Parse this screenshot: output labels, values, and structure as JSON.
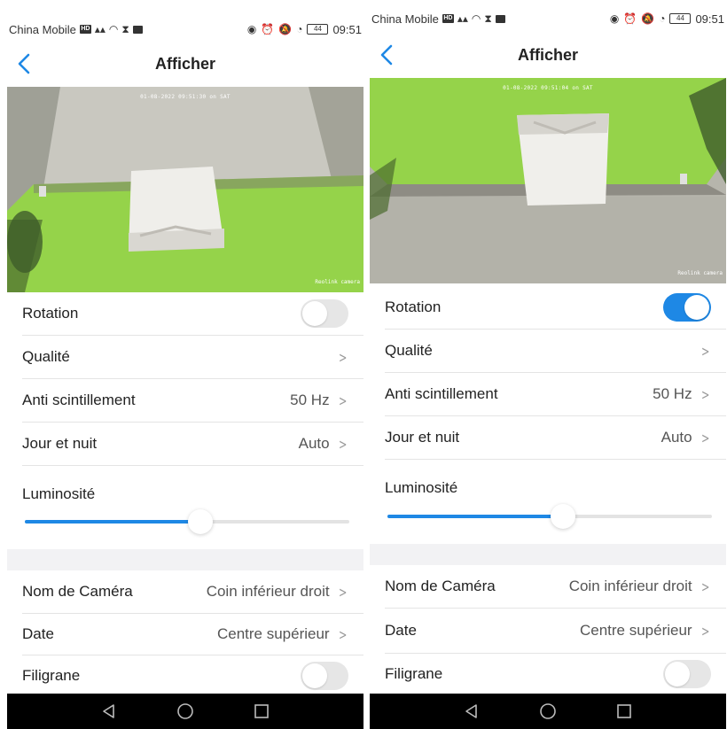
{
  "status_bar": {
    "carrier": "China Mobile",
    "hd_badge": "HD",
    "network": "4G",
    "battery": "44",
    "time": "09:51",
    "time_right": "09:51"
  },
  "header": {
    "title": "Afficher"
  },
  "screens": [
    {
      "video": {
        "timestamp": "01-08-2022 09:51:30 on SAT",
        "camera_name": "Reolink camera"
      },
      "rotation": {
        "label": "Rotation",
        "on": false
      },
      "quality": {
        "label": "Qualité"
      },
      "anti_flicker": {
        "label": "Anti scintillement",
        "value": "50 Hz"
      },
      "day_night": {
        "label": "Jour et nuit",
        "value": "Auto"
      },
      "brightness": {
        "label": "Luminosité",
        "level": 0.54
      },
      "camera_name": {
        "label": "Nom de Caméra",
        "value": "Coin inférieur droit"
      },
      "date": {
        "label": "Date",
        "value": "Centre supérieur"
      },
      "watermark": {
        "label": "Filigrane",
        "on": false
      }
    },
    {
      "video": {
        "timestamp": "01-08-2022 09:51:04 on SAT",
        "camera_name": "Reolink camera"
      },
      "rotation": {
        "label": "Rotation",
        "on": true
      },
      "quality": {
        "label": "Qualité"
      },
      "anti_flicker": {
        "label": "Anti scintillement",
        "value": "50 Hz"
      },
      "day_night": {
        "label": "Jour et nuit",
        "value": "Auto"
      },
      "brightness": {
        "label": "Luminosité",
        "level": 0.54
      },
      "camera_name": {
        "label": "Nom de Caméra",
        "value": "Coin inférieur droit"
      },
      "date": {
        "label": "Date",
        "value": "Centre supérieur"
      },
      "watermark": {
        "label": "Filigrane",
        "on": false
      }
    }
  ],
  "icons": {
    "back": "chevron-left-icon",
    "nav_back": "triangle-back-icon",
    "nav_home": "circle-home-icon",
    "nav_recents": "square-recents-icon"
  },
  "colors": {
    "accent": "#1e88e5",
    "toggle_off": "#e6e6e6",
    "green_wall": "#95d34a"
  }
}
